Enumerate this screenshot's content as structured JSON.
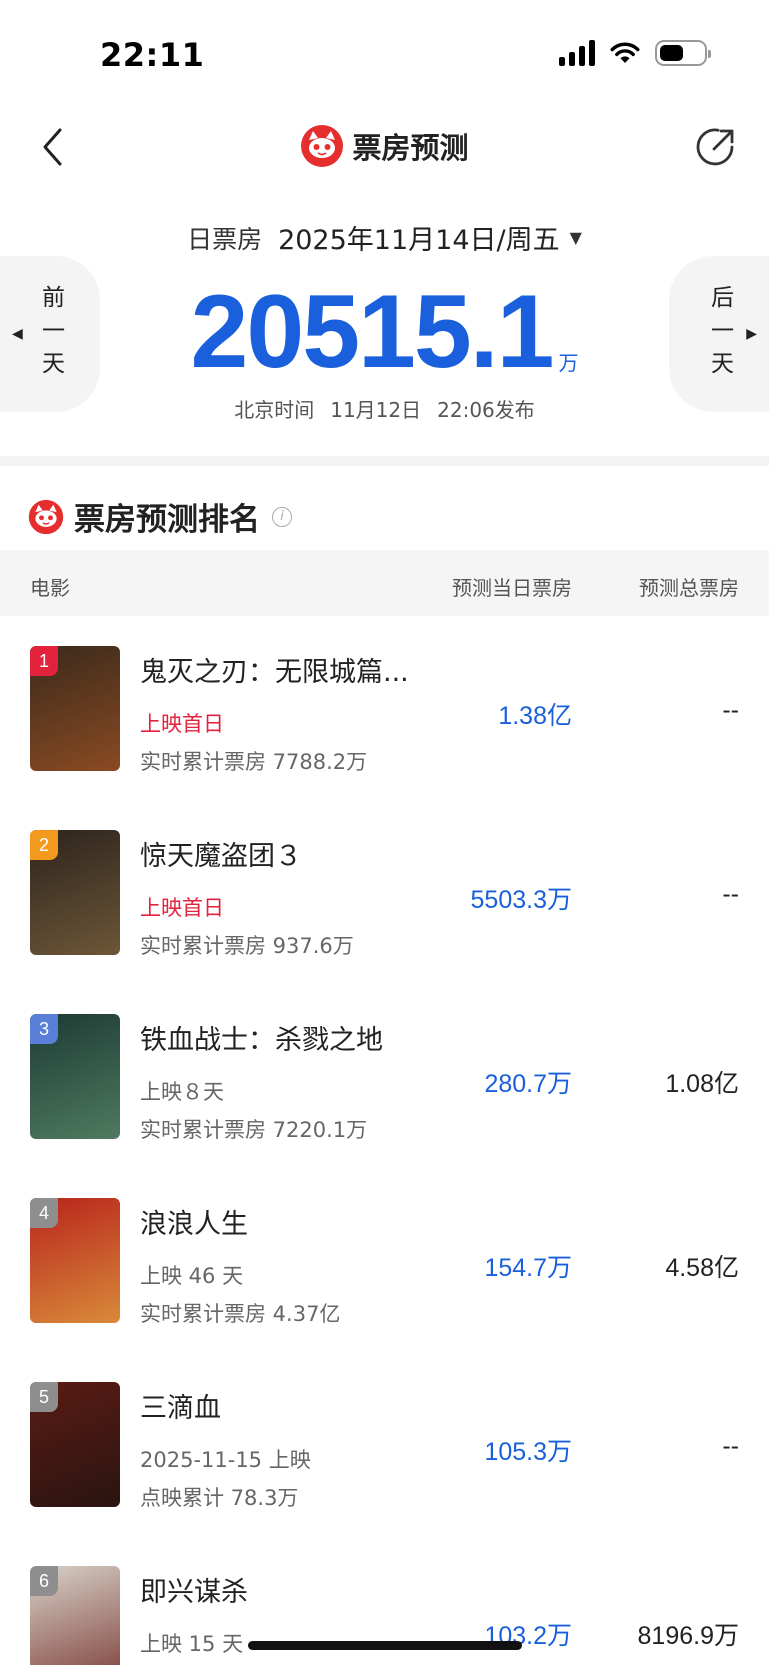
{
  "status_bar": {
    "time": "22:11"
  },
  "nav": {
    "title": "票房预测"
  },
  "date_selector": {
    "type_label": "日票房",
    "date": "2025年11月14日/周五"
  },
  "prev_day": {
    "label": "前一天"
  },
  "next_day": {
    "label": "后一天"
  },
  "forecast": {
    "value": "20515.1",
    "unit": "万",
    "release_city": "北京时间",
    "release_date": "11月12日",
    "release_time": "22:06发布"
  },
  "section": {
    "title": "票房预测排名"
  },
  "table": {
    "headers": {
      "movie": "电影",
      "day": "预测当日票房",
      "total": "预测总票房"
    },
    "rows": [
      {
        "rank": "1",
        "rank_color": "#e3223c",
        "name": "鬼灭之刃：无限城篇...",
        "sub1": "上映首日",
        "sub1_highlight": true,
        "sub2": "实时累计票房 7788.2万",
        "day": "1.38亿",
        "total": "--",
        "poster_colors": [
          "#3a2a1c",
          "#8a4a22"
        ]
      },
      {
        "rank": "2",
        "rank_color": "#f39a1e",
        "name": "惊天魔盗团３",
        "sub1": "上映首日",
        "sub1_highlight": true,
        "sub2": "实时累计票房 937.6万",
        "day": "5503.3万",
        "total": "--",
        "poster_colors": [
          "#2c241c",
          "#6d5638"
        ]
      },
      {
        "rank": "3",
        "rank_color": "#5a7fd8",
        "name": "铁血战士：杀戮之地",
        "sub1": "上映８天",
        "sub1_highlight": false,
        "sub2": "实时累计票房 7220.1万",
        "day": "280.7万",
        "total": "1.08亿",
        "poster_colors": [
          "#1d3a34",
          "#4f7a60"
        ]
      },
      {
        "rank": "4",
        "rank_color": "#8e8e8e",
        "name": "浪浪人生",
        "sub1": "上映 46 天",
        "sub1_highlight": false,
        "sub2": "实时累计票房 4.37亿",
        "day": "154.7万",
        "total": "4.58亿",
        "poster_colors": [
          "#b8241c",
          "#d88a3a"
        ]
      },
      {
        "rank": "5",
        "rank_color": "#8e8e8e",
        "name": "三滴血",
        "sub1": "2025-11-15 上映",
        "sub1_highlight": false,
        "sub2": "点映累计 78.3万",
        "day": "105.3万",
        "total": "--",
        "poster_colors": [
          "#5a1c14",
          "#2a1410"
        ]
      },
      {
        "rank": "6",
        "rank_color": "#8e8e8e",
        "name": "即兴谋杀",
        "sub1": "上映 15 天",
        "sub1_highlight": false,
        "sub2": "",
        "day": "103.2万",
        "total": "8196.9万",
        "poster_colors": [
          "#d8d2c8",
          "#7a3a34"
        ]
      }
    ]
  }
}
